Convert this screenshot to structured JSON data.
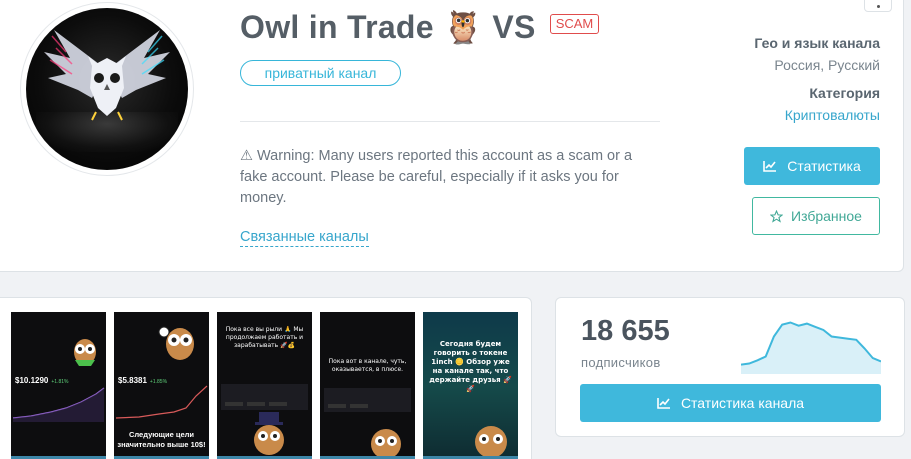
{
  "channel": {
    "title": "Owl in Trade 🦉 VS",
    "scam_badge": "SCAM",
    "private_label": "приватный канал",
    "warning": "⚠ Warning: Many users reported this account as a scam or a fake account. Please be careful, especially if it asks you for money.",
    "related_link": "Связанные каналы"
  },
  "meta": {
    "geo_label": "Гео и язык канала",
    "geo_value": "Россия, Русский",
    "category_label": "Категория",
    "category_value": "Криптовалюты"
  },
  "buttons": {
    "stats": "Статистика",
    "favorites": "Избранное",
    "channel_stats": "Статистика канала"
  },
  "gallery": [
    {
      "price": "$10.1290",
      "pct": "+1.81%",
      "caption": ""
    },
    {
      "price": "$5.8381",
      "pct": "+1.85%",
      "caption": "Следующие цели значительно выше 10$!"
    },
    {
      "top_text": "Пока все вы рыли 🙏 Мы продолжаем работать и зарабатывать 🚀💰",
      "caption": ""
    },
    {
      "top_text": "Пока вот в канале, чуть, оказывается, в плюсе.",
      "caption": ""
    },
    {
      "top_text": "Сегодня будем говорить о токене 1inch 🪙 Обзор уже на канале так, что держайте друзья 🚀🚀",
      "caption": ""
    }
  ],
  "stats": {
    "subscribers": "18 655",
    "subscribers_label": "подписчиков",
    "sparkline": [
      0.1,
      0.12,
      0.18,
      0.25,
      0.62,
      0.84,
      0.88,
      0.82,
      0.86,
      0.8,
      0.74,
      0.62,
      0.6,
      0.58,
      0.56,
      0.4,
      0.22,
      0.16
    ],
    "accent": "#3fb8dc"
  },
  "colors": {
    "accent": "#3fb8dc",
    "scam": "#e04c4c",
    "favorite": "#41a896"
  }
}
